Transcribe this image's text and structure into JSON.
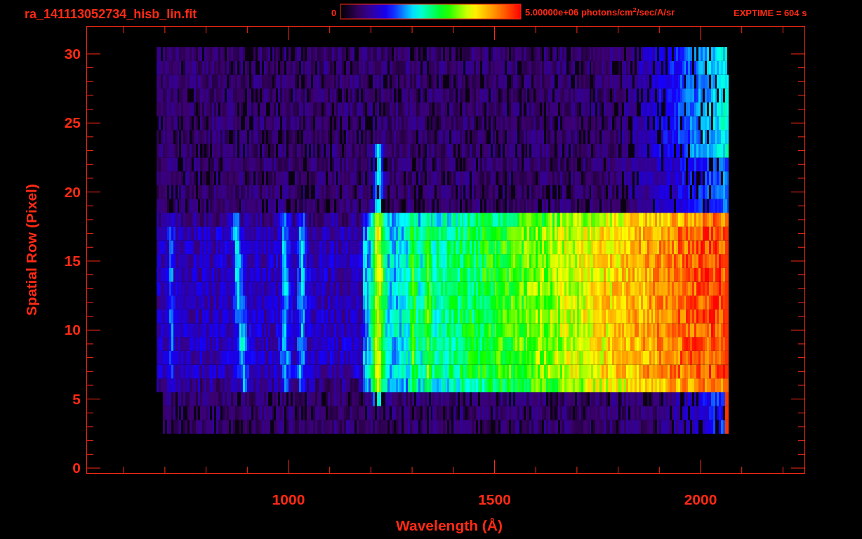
{
  "title": "ra_141113052734_hisb_lin.fit",
  "colorbar": {
    "min_label": "0",
    "max_label": "5.00000e+06 photons/cm$^{2}$/sec/A/sr"
  },
  "exposure": "EXPTIME = 604 s",
  "y_axis": {
    "title": "Spatial Row (Pixel)",
    "ticks": [
      "30",
      "25",
      "20",
      "15",
      "10",
      "5",
      "0"
    ]
  },
  "x_axis": {
    "title": "Wavelength (Å)",
    "ticks": [
      "1000",
      "1500",
      "2000"
    ]
  }
}
